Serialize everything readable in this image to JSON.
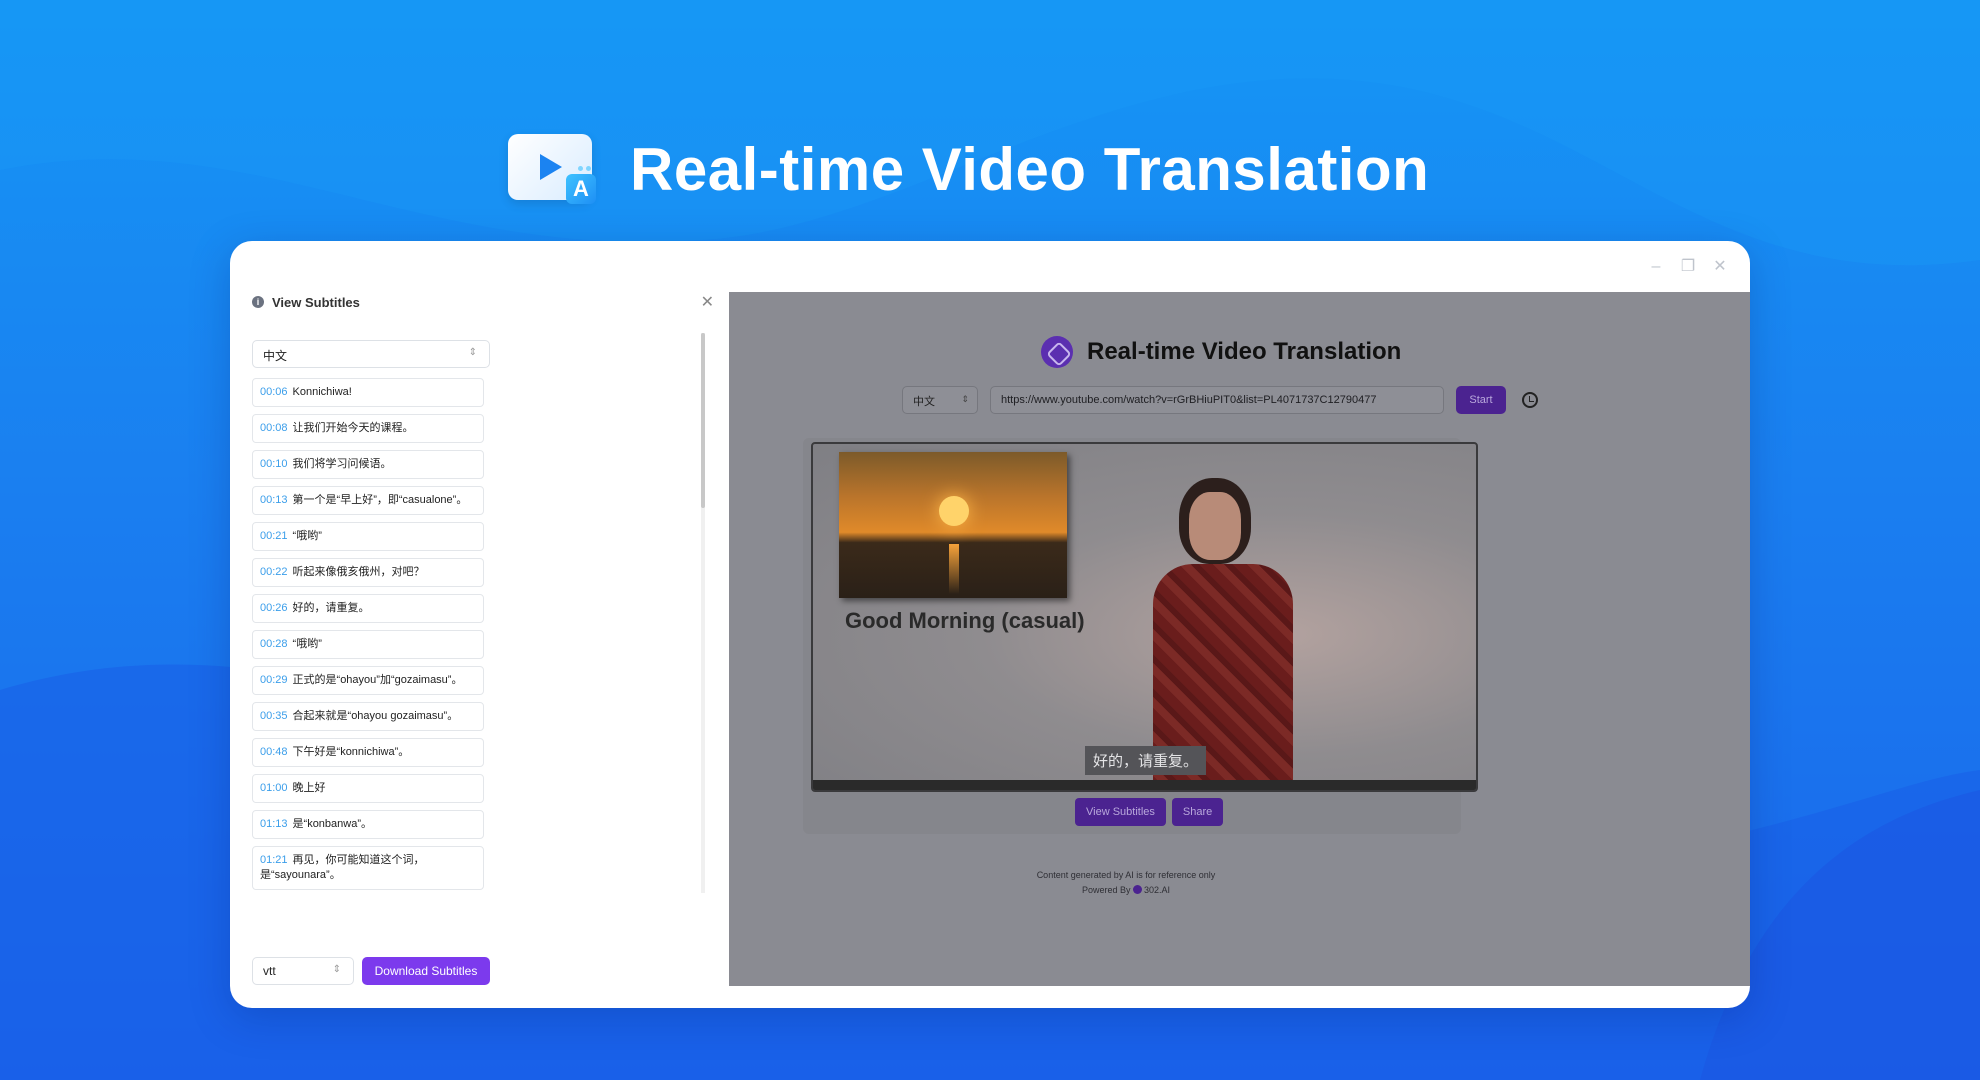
{
  "hero": {
    "title": "Real-time Video Translation",
    "icon_badge": "A"
  },
  "window_controls": [
    "minimize",
    "restore",
    "close"
  ],
  "sidebar": {
    "title": "View Subtitles",
    "language": "中文",
    "subtitles": [
      {
        "time": "00:06",
        "text": "Konnichiwa!"
      },
      {
        "time": "00:08",
        "text": "让我们开始今天的课程。"
      },
      {
        "time": "00:10",
        "text": "我们将学习问候语。"
      },
      {
        "time": "00:13",
        "text": "第一个是“早上好”，即“casualone”。"
      },
      {
        "time": "00:21",
        "text": "“哦哟”"
      },
      {
        "time": "00:22",
        "text": "听起来像俄亥俄州，对吧？"
      },
      {
        "time": "00:26",
        "text": "好的，请重复。"
      },
      {
        "time": "00:28",
        "text": "“哦哟”"
      },
      {
        "time": "00:29",
        "text": "正式的是“ohayou”加“gozaimasu”。"
      },
      {
        "time": "00:35",
        "text": "合起来就是“ohayou gozaimasu”。"
      },
      {
        "time": "00:48",
        "text": "下午好是“konnichiwa”。"
      },
      {
        "time": "01:00",
        "text": "晚上好"
      },
      {
        "time": "01:13",
        "text": "是“konbanwa”。"
      },
      {
        "time": "01:21",
        "text": "再见，你可能知道这个词，是“sayounara”。"
      }
    ],
    "format": "vtt",
    "download_label": "Download Subtitles"
  },
  "app": {
    "title": "Real-time Video Translation",
    "language": "中文",
    "url": "https://www.youtube.com/watch?v=rGrBHiuPIT0&list=PL4071737C12790477",
    "start_label": "Start",
    "video_slide_text": "Good Morning (casual)",
    "caption": "好的，请重复。",
    "view_subtitles_label": "View Subtitles",
    "share_label": "Share",
    "footer_line1": "Content generated by AI is for reference only",
    "footer_line2": "Powered By",
    "footer_brand": "302.AI"
  }
}
